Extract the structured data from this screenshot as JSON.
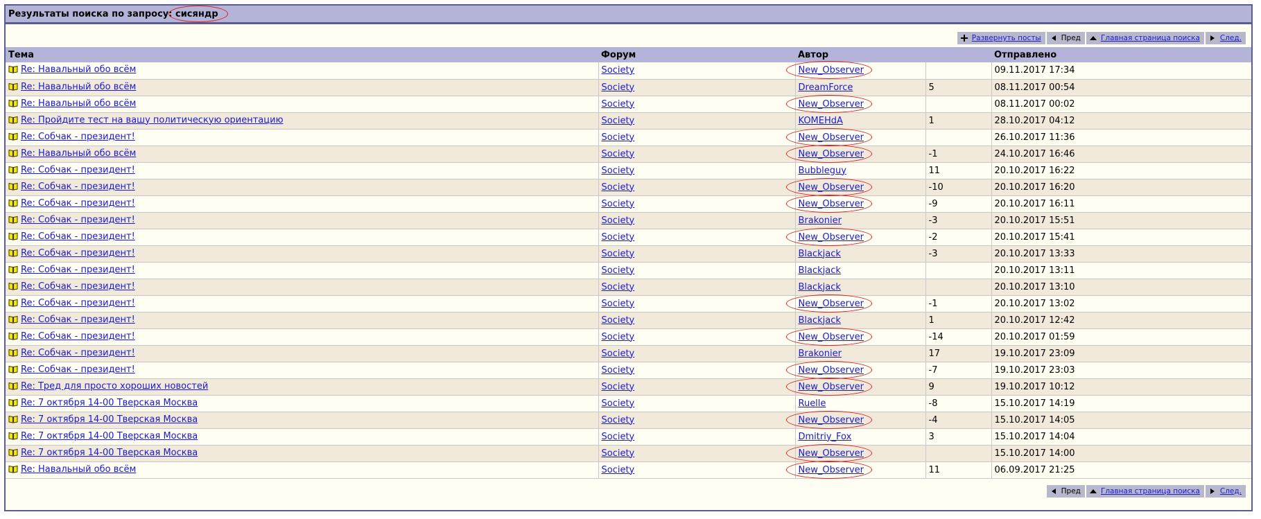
{
  "header": {
    "title_prefix": "Результаты поиска по запросу:",
    "query": "сисяндр"
  },
  "toolbar_top": {
    "expand": "Развернуть посты",
    "prev": "Пред",
    "home": "Главная страница поиска",
    "next": "След."
  },
  "toolbar_bottom": {
    "prev": "Пред",
    "home": "Главная страница поиска",
    "next": "След."
  },
  "columns": {
    "topic": "Тема",
    "forum": "Форум",
    "author": "Автор",
    "rating": "",
    "posted": "Отправлено"
  },
  "rows": [
    {
      "topic": "Re: Навальный обо всём",
      "forum": "Society",
      "author": "New_Observer",
      "rating": "",
      "date": "09.11.2017 17:34",
      "marked": true
    },
    {
      "topic": "Re: Навальный обо всём",
      "forum": "Society",
      "author": "DreamForce",
      "rating": "5",
      "date": "08.11.2017 00:54",
      "marked": false
    },
    {
      "topic": "Re: Навальный обо всём",
      "forum": "Society",
      "author": "New_Observer",
      "rating": "",
      "date": "08.11.2017 00:02",
      "marked": true
    },
    {
      "topic": "Re: Пройдите тест на вашу политическую ориентацию",
      "forum": "Society",
      "author": "KOMEHdA",
      "rating": "1",
      "date": "28.10.2017 04:12",
      "marked": false
    },
    {
      "topic": "Re: Собчак - президент!",
      "forum": "Society",
      "author": "New_Observer",
      "rating": "",
      "date": "26.10.2017 11:36",
      "marked": true
    },
    {
      "topic": "Re: Навальный обо всём",
      "forum": "Society",
      "author": "New_Observer",
      "rating": "-1",
      "date": "24.10.2017 16:46",
      "marked": true
    },
    {
      "topic": "Re: Собчак - президент!",
      "forum": "Society",
      "author": "Bubbleguy",
      "rating": "11",
      "date": "20.10.2017 16:22",
      "marked": false
    },
    {
      "topic": "Re: Собчак - президент!",
      "forum": "Society",
      "author": "New_Observer",
      "rating": "-10",
      "date": "20.10.2017 16:20",
      "marked": true
    },
    {
      "topic": "Re: Собчак - президент!",
      "forum": "Society",
      "author": "New_Observer",
      "rating": "-9",
      "date": "20.10.2017 16:11",
      "marked": true
    },
    {
      "topic": "Re: Собчак - президент!",
      "forum": "Society",
      "author": "Brakonier",
      "rating": "-3",
      "date": "20.10.2017 15:51",
      "marked": false
    },
    {
      "topic": "Re: Собчак - президент!",
      "forum": "Society",
      "author": "New_Observer",
      "rating": "-2",
      "date": "20.10.2017 15:41",
      "marked": true
    },
    {
      "topic": "Re: Собчак - президент!",
      "forum": "Society",
      "author": "Blackjack",
      "rating": "-3",
      "date": "20.10.2017 13:33",
      "marked": false
    },
    {
      "topic": "Re: Собчак - президент!",
      "forum": "Society",
      "author": "Blackjack",
      "rating": "",
      "date": "20.10.2017 13:11",
      "marked": false
    },
    {
      "topic": "Re: Собчак - президент!",
      "forum": "Society",
      "author": "Blackjack",
      "rating": "",
      "date": "20.10.2017 13:10",
      "marked": false
    },
    {
      "topic": "Re: Собчак - президент!",
      "forum": "Society",
      "author": "New_Observer",
      "rating": "-1",
      "date": "20.10.2017 13:02",
      "marked": true
    },
    {
      "topic": "Re: Собчак - президент!",
      "forum": "Society",
      "author": "Blackjack",
      "rating": "1",
      "date": "20.10.2017 12:42",
      "marked": false
    },
    {
      "topic": "Re: Собчак - президент!",
      "forum": "Society",
      "author": "New_Observer",
      "rating": "-14",
      "date": "20.10.2017 01:59",
      "marked": true
    },
    {
      "topic": "Re: Собчак - президент!",
      "forum": "Society",
      "author": "Brakonier",
      "rating": "17",
      "date": "19.10.2017 23:09",
      "marked": false
    },
    {
      "topic": "Re: Собчак - президент!",
      "forum": "Society",
      "author": "New_Observer",
      "rating": "-7",
      "date": "19.10.2017 23:03",
      "marked": true
    },
    {
      "topic": "Re: Тред для просто хороших новостей",
      "forum": "Society",
      "author": "New_Observer",
      "rating": "9",
      "date": "19.10.2017 10:12",
      "marked": true
    },
    {
      "topic": "Re: 7 октября 14-00 Тверская Москва",
      "forum": "Society",
      "author": "Ruelle",
      "rating": "-8",
      "date": "15.10.2017 14:19",
      "marked": false
    },
    {
      "topic": "Re: 7 октября 14-00 Тверская Москва",
      "forum": "Society",
      "author": "New_Observer",
      "rating": "-4",
      "date": "15.10.2017 14:05",
      "marked": true
    },
    {
      "topic": "Re: 7 октября 14-00 Тверская Москва",
      "forum": "Society",
      "author": "Dmitriy_Fox",
      "rating": "3",
      "date": "15.10.2017 14:04",
      "marked": false
    },
    {
      "topic": "Re: 7 октября 14-00 Тверская Москва",
      "forum": "Society",
      "author": "New_Observer",
      "rating": "",
      "date": "15.10.2017 14:00",
      "marked": true
    },
    {
      "topic": "Re: Навальный обо всём",
      "forum": "Society",
      "author": "New_Observer",
      "rating": "11",
      "date": "06.09.2017 21:25",
      "marked": true
    }
  ],
  "colors": {
    "header_bg": "#b4b4d8",
    "border": "#5c5c94",
    "row_light": "#fefef2",
    "row_dark": "#f1eadb",
    "link": "#1a1ad6",
    "highlight_ring": "#e02020"
  },
  "icons": {
    "row": "open-book-icon",
    "expand": "plus-icon",
    "prev": "triangle-left-icon",
    "home": "triangle-up-icon",
    "next": "triangle-right-icon"
  }
}
